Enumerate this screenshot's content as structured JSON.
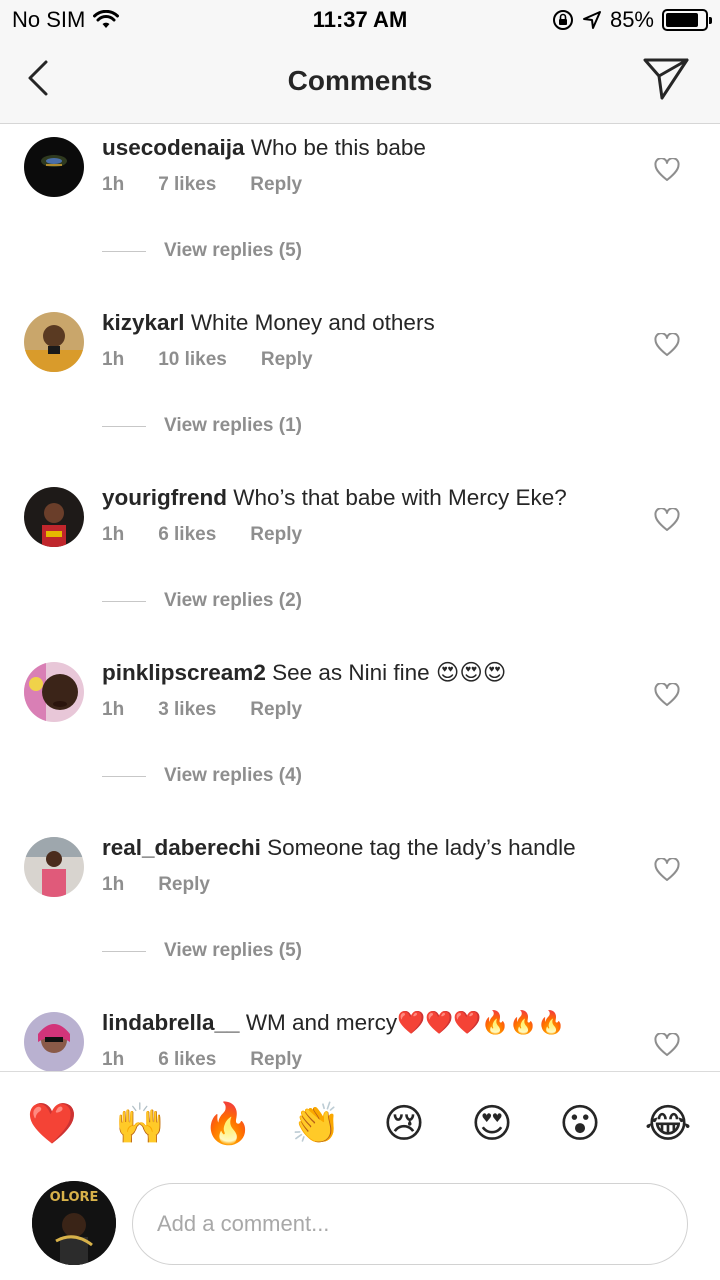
{
  "status": {
    "carrier": "No SIM",
    "time": "11:37 AM",
    "battery": "85%",
    "battery_level": 0.85
  },
  "nav": {
    "title": "Comments"
  },
  "comments": [
    {
      "user": "usecodenaija",
      "text": " Who be this babe",
      "time": "1h",
      "likes": "7 likes",
      "reply": "Reply",
      "view_replies": "View replies (5)"
    },
    {
      "user": "kizykarl",
      "text": " White Money and others",
      "time": "1h",
      "likes": "10 likes",
      "reply": "Reply",
      "view_replies": "View replies (1)"
    },
    {
      "user": "yourigfrend",
      "text": " Who’s that babe with Mercy Eke?",
      "time": "1h",
      "likes": "6 likes",
      "reply": "Reply",
      "view_replies": "View replies (2)"
    },
    {
      "user": "pinklipscream2",
      "text": " See as Nini fine 😍😍😍",
      "time": "1h",
      "likes": "3 likes",
      "reply": "Reply",
      "view_replies": "View replies (4)"
    },
    {
      "user": "real_daberechi",
      "text": " Someone tag the lady’s handle",
      "time": "1h",
      "likes": "",
      "reply": "Reply",
      "view_replies": "View replies (5)"
    },
    {
      "user": "lindabrella__",
      "text": " WM and mercy❤️❤️❤️🔥🔥🔥",
      "time": "1h",
      "likes": "6 likes",
      "reply": "Reply",
      "view_replies": ""
    }
  ],
  "reactions": [
    "❤️",
    "🙌",
    "🔥",
    "👏",
    "😢",
    "😍",
    "😮",
    "😂"
  ],
  "composer": {
    "placeholder": "Add a comment...",
    "avatar_text": "OLORE"
  },
  "colors": {
    "text": "#262626",
    "muted": "#8e8e8e",
    "bar_bg": "#f7f7f7",
    "border": "#dbdbdb"
  }
}
